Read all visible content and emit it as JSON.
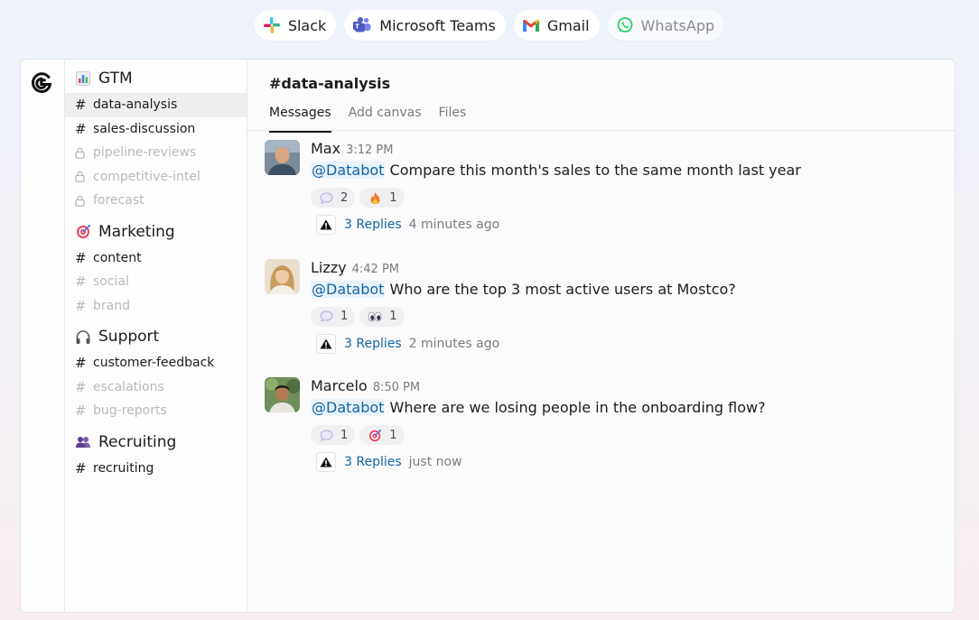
{
  "integrations": [
    {
      "label": "Slack",
      "icon": "slack-icon"
    },
    {
      "label": "Microsoft Teams",
      "icon": "teams-icon"
    },
    {
      "label": "Gmail",
      "icon": "gmail-icon"
    },
    {
      "label": "WhatsApp",
      "icon": "whatsapp-icon"
    }
  ],
  "sidebar": {
    "groups": [
      {
        "title": "GTM",
        "icon": "bar-chart-icon",
        "channels": [
          {
            "name": "data-analysis",
            "state": "active"
          },
          {
            "name": "sales-discussion",
            "state": "normal"
          },
          {
            "name": "pipeline-reviews",
            "state": "locked"
          },
          {
            "name": "competitive-intel",
            "state": "locked"
          },
          {
            "name": "forecast",
            "state": "locked"
          }
        ]
      },
      {
        "title": "Marketing",
        "icon": "target-icon",
        "channels": [
          {
            "name": "content",
            "state": "normal"
          },
          {
            "name": "social",
            "state": "muted"
          },
          {
            "name": "brand",
            "state": "muted"
          }
        ]
      },
      {
        "title": "Support",
        "icon": "headphones-icon",
        "channels": [
          {
            "name": "customer-feedback",
            "state": "normal"
          },
          {
            "name": "escalations",
            "state": "muted"
          },
          {
            "name": "bug-reports",
            "state": "muted"
          }
        ]
      },
      {
        "title": "Recruiting",
        "icon": "people-icon",
        "channels": [
          {
            "name": "recruiting",
            "state": "normal"
          }
        ]
      }
    ]
  },
  "channel": {
    "title": "#data-analysis",
    "tabs": [
      "Messages",
      "Add canvas",
      "Files"
    ],
    "active_tab": "Messages"
  },
  "messages": [
    {
      "author": "Max",
      "time": "3:12 PM",
      "mention": "@Databot",
      "text": "Compare this month's sales to the same month last year",
      "reactions": [
        {
          "icon": "speech-bubble-icon",
          "count": "2"
        },
        {
          "icon": "fire-icon",
          "count": "1"
        }
      ],
      "replies": "3 Replies",
      "ago": "4 minutes ago"
    },
    {
      "author": "Lizzy",
      "time": "4:42 PM",
      "mention": "@Databot",
      "text": "Who are the top 3 most active users at Mostco?",
      "reactions": [
        {
          "icon": "speech-bubble-icon",
          "count": "1"
        },
        {
          "icon": "eyes-icon",
          "count": "1"
        }
      ],
      "replies": "3 Replies",
      "ago": "2 minutes ago"
    },
    {
      "author": "Marcelo",
      "time": "8:50 PM",
      "mention": "@Databot",
      "text": "Where are we losing people in the onboarding flow?",
      "reactions": [
        {
          "icon": "speech-bubble-icon",
          "count": "1"
        },
        {
          "icon": "target-icon",
          "count": "1"
        }
      ],
      "replies": "3 Replies",
      "ago": "just now"
    }
  ],
  "colors": {
    "link": "#1264a3",
    "mention_bg": "#e8f3fb",
    "muted_text": "#b8b9be"
  }
}
